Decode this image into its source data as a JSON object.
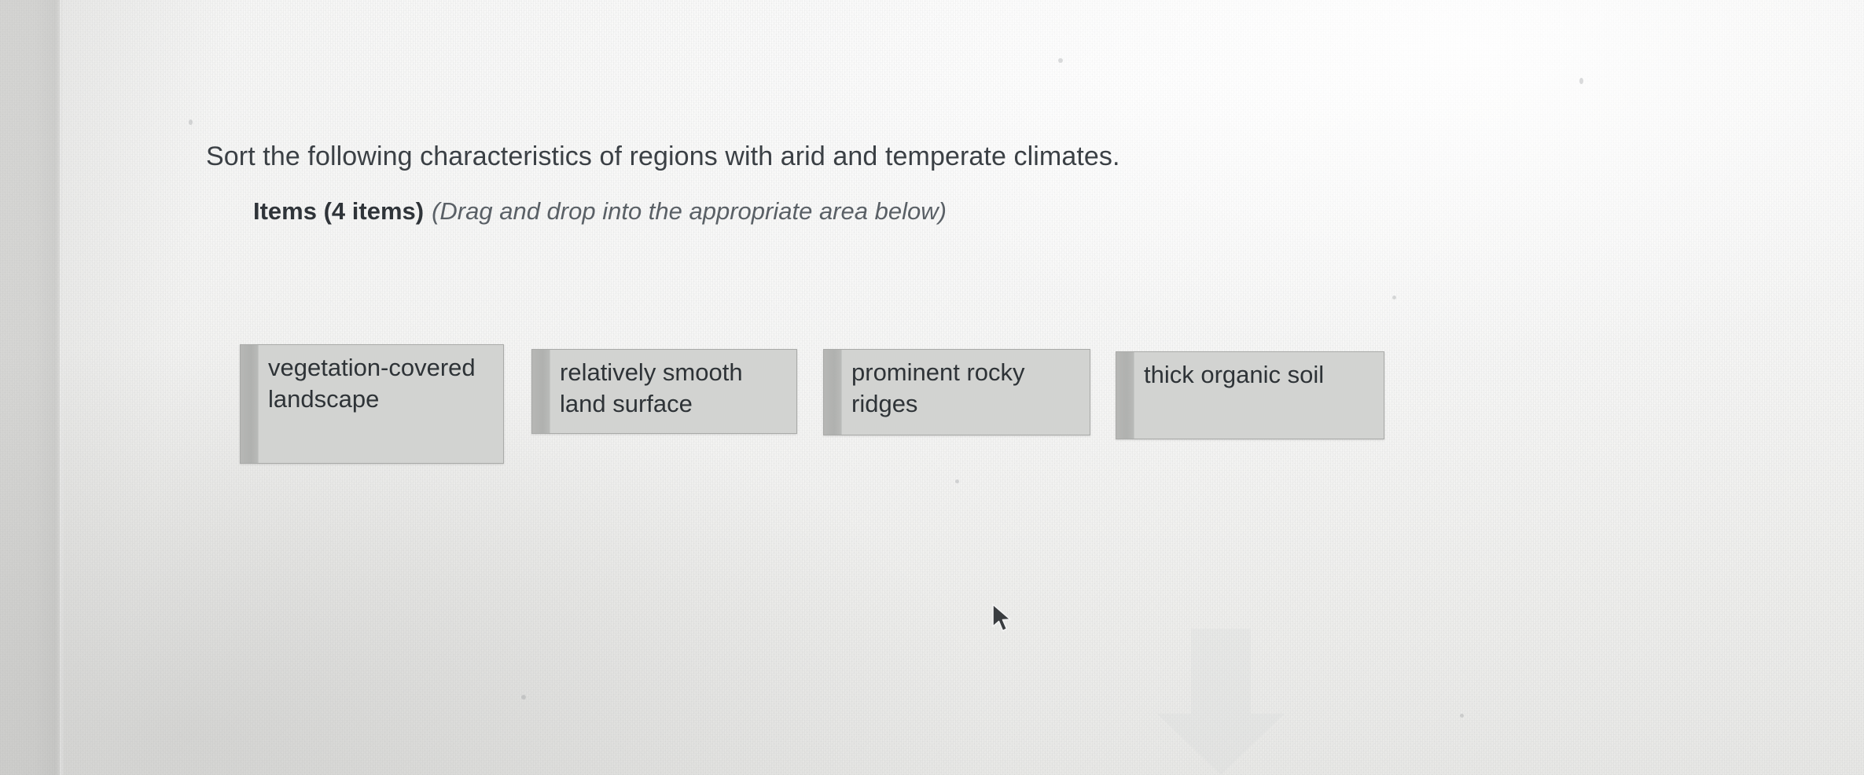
{
  "question": {
    "prompt": "Sort the following characteristics of regions with arid and temperate climates.",
    "items_label": "Items (4 items)",
    "items_hint": "(Drag and drop into the appropriate area below)"
  },
  "items": [
    {
      "label": "vegetation-covered landscape",
      "grip_icon": "drag-handle-icon"
    },
    {
      "label": "relatively smooth land surface",
      "grip_icon": "drag-handle-icon"
    },
    {
      "label": "prominent rocky ridges",
      "grip_icon": "drag-handle-icon"
    },
    {
      "label": "thick organic soil",
      "grip_icon": "drag-handle-icon"
    }
  ],
  "drop_zone": {
    "icon": "down-arrow-icon"
  },
  "pointer": {
    "icon": "mouse-cursor-icon"
  },
  "colors": {
    "background": "#f2f2f0",
    "text": "#3b4045",
    "card_fill": "#d2d3d1",
    "card_border": "#a9aaa8",
    "grip_fill": "#b0b1af"
  }
}
